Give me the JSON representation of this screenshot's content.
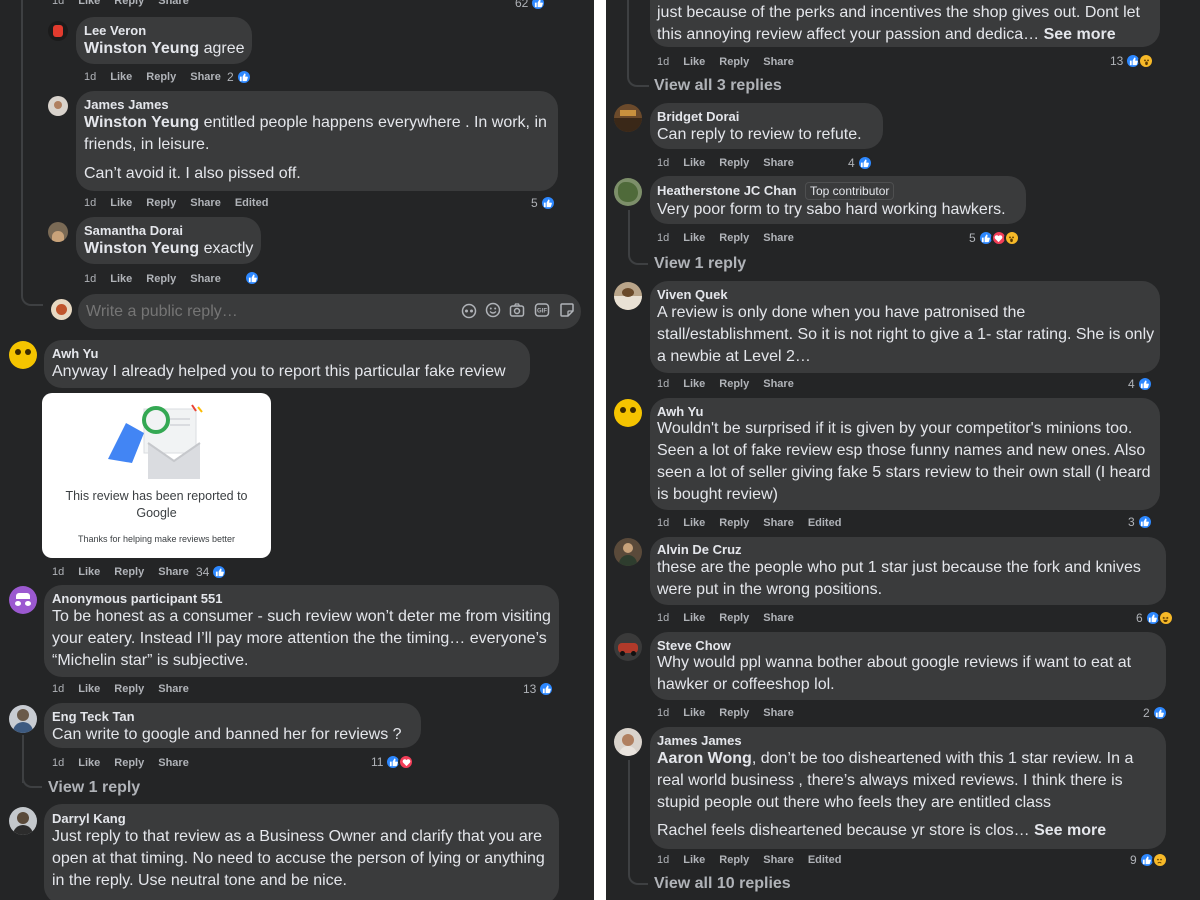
{
  "common": {
    "age": "1d",
    "like": "Like",
    "reply": "Reply",
    "share": "Share",
    "edited": "Edited",
    "see_more": "See more"
  },
  "left": {
    "c1": {
      "name": "Lee Veron",
      "mention": "Winston Yeung",
      "text": " agree",
      "count": "2"
    },
    "c2": {
      "name": "James James",
      "mention": "Winston Yeung",
      "text": " entitled people happens everywhere . In work, in friends, in leisure.",
      "text2": "Can’t avoid it. I also pissed off.",
      "count": "5"
    },
    "c3": {
      "name": "Samantha Dorai",
      "mention": "Winston Yeung",
      "text": " exactly"
    },
    "reply_box": {
      "placeholder": "Write a public reply…"
    },
    "c4": {
      "name": "Awh Yu",
      "text": "Anyway I already helped you to report this particular fake review",
      "card_title": "This review has been reported to Google",
      "card_sub": "Thanks for helping make reviews better",
      "count": "34"
    },
    "c5": {
      "name": "Anonymous participant 551",
      "text": "To be honest as a consumer - such review won’t deter me from visiting your eatery. Instead I’ll pay more attention the the timing… everyone’s “Michelin star” is subjective.",
      "count": "13"
    },
    "c6": {
      "name": "Eng Teck Tan",
      "text": "Can write to google and banned her for reviews ?",
      "count": "11",
      "view_replies": "View 1 reply"
    },
    "c7": {
      "name": "Darryl Kang",
      "text": "Just reply to that review as a Business Owner and clarify that you are open at that timing. No need to accuse the person of lying or anything in the reply. Use neutral tone and be nice."
    }
  },
  "right": {
    "c0": {
      "text": "just because of the perks and incentives the shop gives out. Dont let this annoying review affect your passion and dedica…",
      "count": "13",
      "view_replies": "View all 3 replies"
    },
    "c1": {
      "name": "Bridget Dorai",
      "text": "Can reply to review to refute.",
      "count": "4"
    },
    "c2": {
      "name": "Heatherstone JC Chan",
      "badge": "Top contributor",
      "text": "Very poor form to try sabo hard working hawkers.",
      "count": "5",
      "view_replies": "View 1 reply"
    },
    "c3": {
      "name": "Viven Quek",
      "text": "A review is only done when you have patronised the stall/establishment. So it is not right to give a 1- star rating. She is only a newbie at Level 2…",
      "count": "4"
    },
    "c4": {
      "name": "Awh Yu",
      "text": "Wouldn't be surprised if it is given by your competitor's minions too. Seen a lot of fake review esp those funny names and new ones. Also seen a lot of seller giving fake 5 stars review to their own stall (I heard is bought review)",
      "count": "3"
    },
    "c5": {
      "name": "Alvin De Cruz",
      "text": "these are the people who put 1 star just because the fork and knives were put in the wrong positions.",
      "count": "6"
    },
    "c6": {
      "name": "Steve Chow",
      "text": "Why would ppl wanna bother about google reviews if want to eat at hawker or coffeeshop lol.",
      "count": "2"
    },
    "c7": {
      "name": "James James",
      "mention": "Aaron Wong",
      "text": ", don’t be too disheartened with this 1 star review. In a real world business , there’s always mixed reviews. I think there is stupid people out there who feels they are entitled class",
      "text2": "Rachel feels disheartened because yr store is clos…",
      "count": "9",
      "view_replies": "View all 10 replies"
    }
  },
  "colors": {
    "bg": "#242526",
    "bubble": "#3a3b3c",
    "like": "#2d88ff",
    "love": "#f33e58",
    "haha": "#f7b928",
    "muted": "#b0b3b8"
  }
}
